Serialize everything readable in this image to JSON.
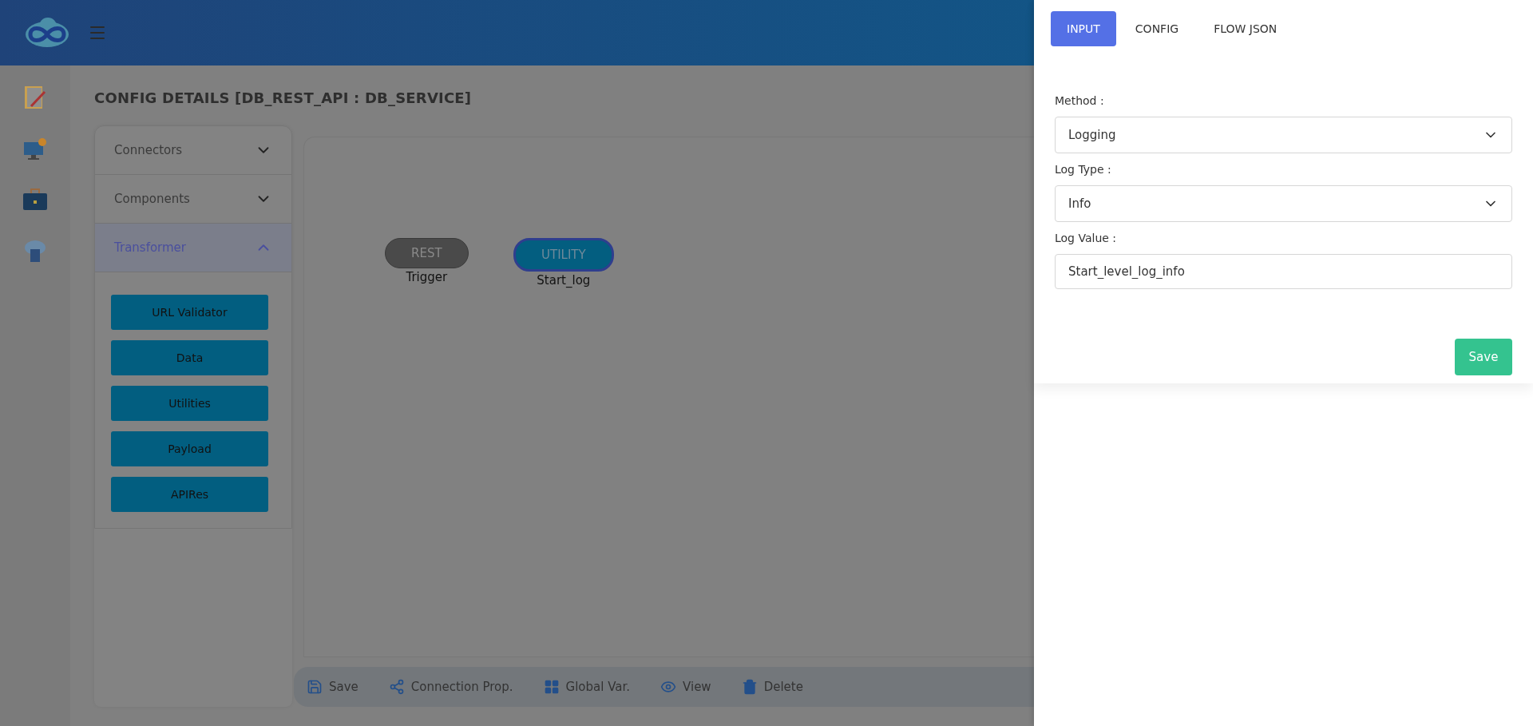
{
  "page_title": "CONFIG DETAILS [DB_REST_API : DB_SERVICE]",
  "palette": {
    "sections": [
      {
        "title": "Connectors",
        "expanded": false
      },
      {
        "title": "Components",
        "expanded": false
      },
      {
        "title": "Transformer",
        "expanded": true,
        "items": [
          "URL Validator",
          "Data",
          "Utilities",
          "Payload",
          "APIRes"
        ]
      }
    ]
  },
  "canvas": {
    "nodes": [
      {
        "kind": "trigger",
        "type": "REST",
        "label": "Trigger",
        "selected": false
      },
      {
        "kind": "utility",
        "type": "UTILITY",
        "label": "Start_log",
        "selected": true
      }
    ]
  },
  "toolbar": [
    {
      "kind": "save",
      "label": "Save"
    },
    {
      "kind": "connection",
      "label": "Connection Prop."
    },
    {
      "kind": "global",
      "label": "Global Var."
    },
    {
      "kind": "view",
      "label": "View"
    },
    {
      "kind": "delete",
      "label": "Delete"
    }
  ],
  "drawer": {
    "tabs": [
      {
        "label": "INPUT",
        "selected": true
      },
      {
        "label": "CONFIG",
        "selected": false
      },
      {
        "label": "FLOW JSON",
        "selected": false
      }
    ],
    "fields": [
      {
        "kind": "select",
        "label": "Method :",
        "value": "Logging"
      },
      {
        "kind": "select",
        "label": "Log Type :",
        "value": "Info"
      },
      {
        "kind": "input",
        "label": "Log Value :",
        "value": "Start_level_log_info"
      }
    ],
    "save_button": "Save"
  }
}
